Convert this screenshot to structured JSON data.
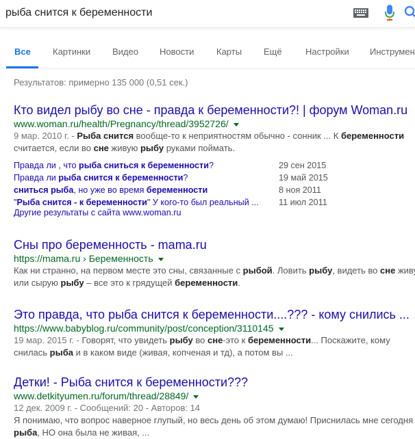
{
  "search": {
    "query": "рыба снится к беременности"
  },
  "icons": {
    "keyboard": "keyboard-icon",
    "mic": "microphone-icon",
    "search": "search-icon"
  },
  "tabs": [
    {
      "label": "Все",
      "active": true
    },
    {
      "label": "Картинки"
    },
    {
      "label": "Видео"
    },
    {
      "label": "Новости"
    },
    {
      "label": "Карты"
    },
    {
      "label": "Ещё"
    },
    {
      "label": "Настройки"
    },
    {
      "label": "Инструменты"
    }
  ],
  "stats": "Результатов: примерно 135 000 (0,51 сек.)",
  "results": [
    {
      "title": "Кто видел рыбу во сне - правда к беременности?! | форум Woman.ru",
      "url": "www.woman.ru/health/Pregnancy/thread/3952726/",
      "date": "9 мар. 2010 г. -",
      "snippet_line1_parts": [
        " ",
        "Рыба снится",
        " вообще-то к неприятностям обычно - сонник ... К ",
        "беременности"
      ],
      "snippet_line2_parts": [
        "считается, если во ",
        "сне",
        " живую ",
        "рыбу",
        " руками поймать."
      ]
    },
    {
      "title": "Сны про беременность - mama.ru",
      "url": "https://mama.ru › Беременность",
      "snippet_line1_parts": [
        "Как ни странно, на первом месте это сны, связанные с ",
        "рыбой",
        ". Ловить ",
        "рыбу",
        ", видеть во ",
        "сне",
        " живу"
      ],
      "snippet_line2_parts": [
        "или сырую ",
        "рыбу",
        " – все это к грядущей ",
        "беременности",
        "."
      ]
    },
    {
      "title": "Это правда, что рыба снится к беременности....??? - кому снились ...",
      "url": "https://www.babyblog.ru/community/post/conception/3110145",
      "date": "19 мар. 2015 г. -",
      "snippet_line1_parts": [
        " Говорят, что увидеть ",
        "рыбу",
        " во ",
        "сне",
        "-это к ",
        "беременности",
        "... Поскажите, кому"
      ],
      "snippet_line2_parts": [
        "снилась ",
        "рыба",
        " и в каком виде (живая, копченая и тд), а потом вы ..."
      ]
    },
    {
      "title": "Детки! - Рыба снится к беременности???",
      "url": "www.detkityumen.ru/forum/thread/28849/",
      "meta": "12 дек. 2009 г. - Сообщений: 20 - Авторов: 14",
      "snippet_line1_parts": [
        "Я понимаю, что вопрос наверное глупый, но весь день об этом думаю! Приснилась мне сегодня"
      ],
      "snippet_line2_parts": [
        "рыба",
        ", НО она была не живая, ..."
      ]
    }
  ],
  "sitelinks": [
    {
      "parts": [
        "Правда ли , что ",
        "рыба сниться к беременности",
        "?"
      ],
      "date": "29 сен 2015"
    },
    {
      "parts": [
        "Правда ли ",
        "рыба снится к беременности",
        "?"
      ],
      "date": "19 май 2015"
    },
    {
      "parts": [
        "",
        "сниться рыба",
        ", но уже во время ",
        "беременности"
      ],
      "date": "8 ноя 2011"
    },
    {
      "parts": [
        "\"",
        "Рыба снится - к беременности",
        "\" У кого-то был реальный ..."
      ],
      "date": "11 июл 2011"
    }
  ],
  "more_results": "Другие результаты с сайта www.woman.ru"
}
